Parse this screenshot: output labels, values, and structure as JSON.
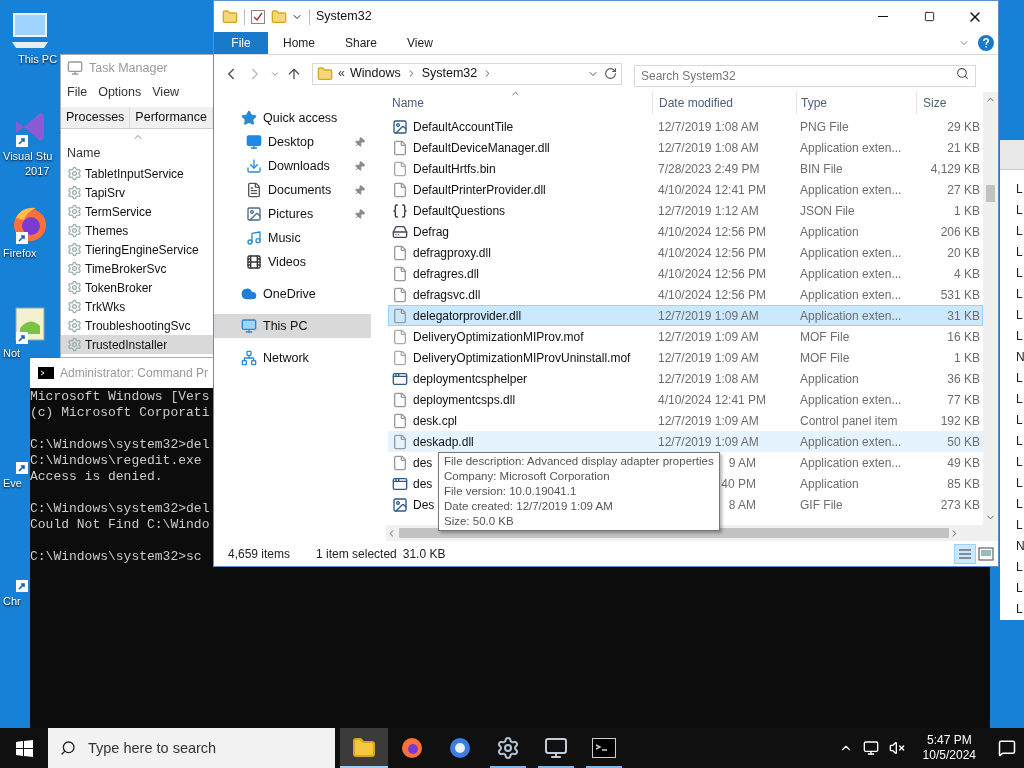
{
  "desktop": {
    "icons": [
      {
        "label": [
          "This PC"
        ],
        "shortcut": false
      },
      {
        "label": [
          "Visual Stu",
          "2017"
        ],
        "shortcut": true
      },
      {
        "label": [
          "Firefox"
        ],
        "shortcut": true
      },
      {
        "label": [
          "Not"
        ],
        "shortcut": true
      },
      {
        "label": [
          "Eve"
        ],
        "shortcut": true
      },
      {
        "label": [
          "Chr"
        ],
        "shortcut": true
      }
    ]
  },
  "task_manager": {
    "title": "Task Manager",
    "menu": [
      "File",
      "Options",
      "View"
    ],
    "tabs": [
      {
        "label": "Processes",
        "selected": false
      },
      {
        "label": "Performance",
        "selected": false
      }
    ],
    "column": "Name",
    "rows": [
      {
        "name": "TabletInputService",
        "selected": false
      },
      {
        "name": "TapiSrv",
        "selected": false
      },
      {
        "name": "TermService",
        "selected": false
      },
      {
        "name": "Themes",
        "selected": false
      },
      {
        "name": "TieringEngineService",
        "selected": false
      },
      {
        "name": "TimeBrokerSvc",
        "selected": false
      },
      {
        "name": "TokenBroker",
        "selected": false
      },
      {
        "name": "TrkWks",
        "selected": false
      },
      {
        "name": "TroubleshootingSvc",
        "selected": false
      },
      {
        "name": "TrustedInstaller",
        "selected": true
      }
    ]
  },
  "right_window": {
    "column_1": [
      "L",
      "L",
      "L",
      "L",
      "L",
      "L",
      "L",
      "L",
      "N",
      "L",
      "L",
      "L",
      "L",
      "L",
      "L",
      "L",
      "L",
      "N",
      "L",
      "L",
      "L"
    ]
  },
  "cmd": {
    "title": "Administrator: Command Pr",
    "blocks": [
      [
        "Microsoft Windows [Vers",
        "(c) Microsoft Corporati"
      ],
      [
        "C:\\Windows\\system32>del",
        "C:\\Windows\\regedit.exe",
        "Access is denied."
      ],
      [
        "C:\\Windows\\system32>del",
        "Could Not Find C:\\Windo"
      ],
      [
        "C:\\Windows\\system32>sc"
      ]
    ]
  },
  "explorer": {
    "title": "System32",
    "ribbon_tabs": [
      {
        "label": "File",
        "selected": true
      },
      {
        "label": "Home",
        "selected": false
      },
      {
        "label": "Share",
        "selected": false
      },
      {
        "label": "View",
        "selected": false
      }
    ],
    "address": {
      "overflow": "«",
      "crumbs": [
        "Windows",
        "System32"
      ]
    },
    "search": {
      "placeholder": "Search System32"
    },
    "nav": [
      {
        "label": "Quick access",
        "pinned": false,
        "selected": false,
        "children": [
          {
            "label": "Desktop",
            "pinned": true,
            "selected": false
          },
          {
            "label": "Downloads",
            "pinned": true,
            "selected": false
          },
          {
            "label": "Documents",
            "pinned": true,
            "selected": false
          },
          {
            "label": "Pictures",
            "pinned": true,
            "selected": false
          },
          {
            "label": "Music",
            "pinned": false,
            "selected": false
          },
          {
            "label": "Videos",
            "pinned": false,
            "selected": false
          }
        ]
      },
      {
        "label": "OneDrive",
        "pinned": false,
        "selected": false
      },
      {
        "label": "This PC",
        "pinned": false,
        "selected": true
      },
      {
        "label": "Network",
        "pinned": false,
        "selected": false
      }
    ],
    "columns": [
      "Name",
      "Date modified",
      "Type",
      "Size"
    ],
    "rows": [
      {
        "kind": "full",
        "name": "DefaultAccountTile",
        "date": "12/7/2019 1:08 AM",
        "type": "PNG File",
        "size": "29 KB",
        "selected": false,
        "hovered": false
      },
      {
        "kind": "full",
        "name": "DefaultDeviceManager.dll",
        "date": "12/7/2019 1:08 AM",
        "type": "Application exten...",
        "size": "21 KB",
        "selected": false,
        "hovered": false
      },
      {
        "kind": "full",
        "name": "DefaultHrtfs.bin",
        "date": "7/28/2023 2:49 PM",
        "type": "BIN File",
        "size": "4,129 KB",
        "selected": false,
        "hovered": false
      },
      {
        "kind": "full",
        "name": "DefaultPrinterProvider.dll",
        "date": "4/10/2024 12:41 PM",
        "type": "Application exten...",
        "size": "27 KB",
        "selected": false,
        "hovered": false
      },
      {
        "kind": "full",
        "name": "DefaultQuestions",
        "date": "12/7/2019 1:12 AM",
        "type": "JSON File",
        "size": "1 KB",
        "selected": false,
        "hovered": false
      },
      {
        "kind": "full",
        "name": "Defrag",
        "date": "4/10/2024 12:56 PM",
        "type": "Application",
        "size": "206 KB",
        "selected": false,
        "hovered": false
      },
      {
        "kind": "full",
        "name": "defragproxy.dll",
        "date": "4/10/2024 12:56 PM",
        "type": "Application exten...",
        "size": "20 KB",
        "selected": false,
        "hovered": false
      },
      {
        "kind": "full",
        "name": "defragres.dll",
        "date": "4/10/2024 12:56 PM",
        "type": "Application exten...",
        "size": "4 KB",
        "selected": false,
        "hovered": false
      },
      {
        "kind": "full",
        "name": "defragsvc.dll",
        "date": "4/10/2024 12:56 PM",
        "type": "Application exten...",
        "size": "531 KB",
        "selected": false,
        "hovered": false
      },
      {
        "kind": "full",
        "name": "delegatorprovider.dll",
        "date": "12/7/2019 1:09 AM",
        "type": "Application exten...",
        "size": "31 KB",
        "selected": true,
        "hovered": false
      },
      {
        "kind": "full",
        "name": "DeliveryOptimizationMIProv.mof",
        "date": "12/7/2019 1:09 AM",
        "type": "MOF File",
        "size": "16 KB",
        "selected": false,
        "hovered": false
      },
      {
        "kind": "full",
        "name": "DeliveryOptimizationMIProvUninstall.mof",
        "date": "12/7/2019 1:09 AM",
        "type": "MOF File",
        "size": "1 KB",
        "selected": false,
        "hovered": false
      },
      {
        "kind": "full",
        "name": "deploymentcsphelper",
        "date": "12/7/2019 1:08 AM",
        "type": "Application",
        "size": "36 KB",
        "selected": false,
        "hovered": false
      },
      {
        "kind": "full",
        "name": "deploymentcsps.dll",
        "date": "4/10/2024 12:41 PM",
        "type": "Application exten...",
        "size": "77 KB",
        "selected": false,
        "hovered": false
      },
      {
        "kind": "full",
        "name": "desk.cpl",
        "date": "12/7/2019 1:09 AM",
        "type": "Control panel item",
        "size": "192 KB",
        "selected": false,
        "hovered": false
      },
      {
        "kind": "full",
        "name": "deskadp.dll",
        "date": "12/7/2019 1:09 AM",
        "type": "Application exten...",
        "size": "50 KB",
        "selected": false,
        "hovered": true
      },
      {
        "kind": "covered",
        "name": "des",
        "date": "9 AM",
        "type": "Application exten...",
        "size": "49 KB",
        "selected": false,
        "hovered": false
      },
      {
        "kind": "covered",
        "name": "des",
        "date": "40 PM",
        "type": "Application",
        "size": "85 KB",
        "selected": false,
        "hovered": false
      },
      {
        "kind": "covered",
        "name": "Des",
        "date": "8 AM",
        "type": "GIF File",
        "size": "273 KB",
        "selected": false,
        "hovered": false
      }
    ],
    "tooltip": [
      "File description: Advanced display adapter properties",
      "Company: Microsoft Corporation",
      "File version: 10.0.19041.1",
      "Date created: 12/7/2019 1:09 AM",
      "Size: 50.0 KB"
    ],
    "status": {
      "items": "4,659 items",
      "selection": "1 item selected",
      "size": "31.0 KB"
    }
  },
  "taskbar": {
    "search": {
      "placeholder": "Type here to search"
    },
    "apps": [
      {
        "running": true,
        "active": true
      },
      {
        "running": false,
        "active": false
      },
      {
        "running": false,
        "active": false
      },
      {
        "running": true,
        "active": false
      },
      {
        "running": true,
        "active": false
      },
      {
        "running": true,
        "active": false
      }
    ],
    "time": "5:47 PM",
    "date": "10/5/2024"
  }
}
